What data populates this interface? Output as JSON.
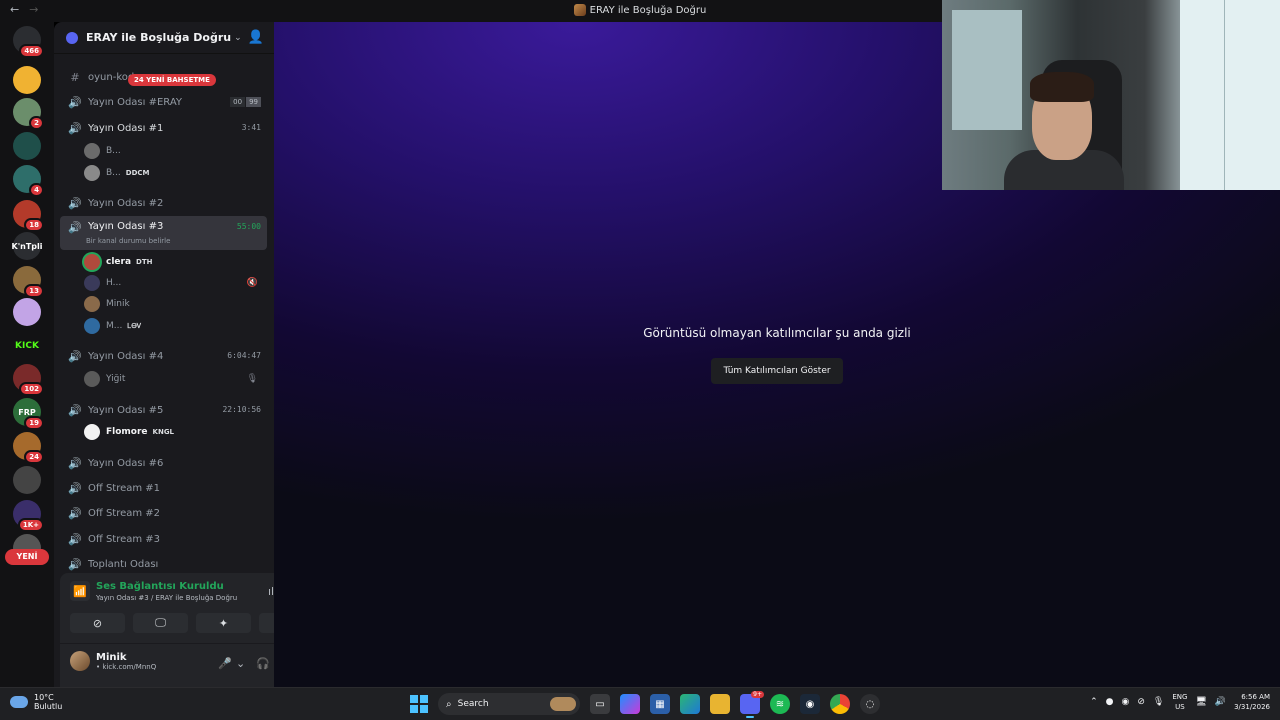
{
  "window": {
    "title": "ERAY ile Boşluğa Doğru",
    "back": "←",
    "forward": "→"
  },
  "rail": {
    "servers": [
      {
        "label": "",
        "badge": "466",
        "color": "#2b2d31"
      },
      {
        "label": "",
        "badge": "",
        "color": "#f0b232"
      },
      {
        "label": "",
        "badge": "2",
        "color": "#6b8e6b"
      },
      {
        "label": "",
        "badge": "",
        "color": "#1f4f4a"
      },
      {
        "label": "",
        "badge": "4",
        "color": "#2e6e6a"
      },
      {
        "label": "",
        "badge": "18",
        "color": "#b33a2a"
      },
      {
        "label": "K'nTpli",
        "badge": "",
        "color": "#2b2d31"
      },
      {
        "label": "",
        "badge": "13",
        "color": "#8a6a3c"
      },
      {
        "label": "",
        "badge": "",
        "color": "#c2a4e6"
      },
      {
        "label": "KICK",
        "badge": "",
        "color": "#121214"
      },
      {
        "label": "",
        "badge": "102",
        "color": "#7a2a2a"
      },
      {
        "label": "FRP",
        "badge": "19",
        "color": "#2c6e3a"
      },
      {
        "label": "",
        "badge": "24",
        "color": "#a66a2c"
      },
      {
        "label": "",
        "badge": "",
        "color": "#444"
      },
      {
        "label": "",
        "badge": "1K+",
        "color": "#3a2e6a"
      },
      {
        "label": "",
        "badge": "",
        "color": "#555"
      }
    ],
    "new_label": "YENİ"
  },
  "server": {
    "name": "ERAY ile Boşluğa Doğru"
  },
  "mention_pill": "24 YENİ BAHSETME",
  "channels": {
    "oyun": "oyun-kodu",
    "c1": {
      "name": "Yayın Odası #ERAY",
      "count_a": "00",
      "count_b": "99"
    },
    "c2": {
      "name": "Yayın Odası #1",
      "timer": "3:41"
    },
    "c2_users": [
      {
        "name": "B...",
        "tag": ""
      },
      {
        "name": "B...",
        "tag": "DDCM"
      }
    ],
    "c3": {
      "name": "Yayın Odası #2"
    },
    "c4": {
      "name": "Yayın Odası #3",
      "timer": "55:00",
      "status": "Bir kanal durumu belirle"
    },
    "c4_users": [
      {
        "name": "clera",
        "tag": "DTH"
      },
      {
        "name": "H...",
        "tag": ""
      },
      {
        "name": "Minik",
        "tag": ""
      },
      {
        "name": "M...",
        "tag": "ᏞᎾᏙ"
      }
    ],
    "c5": {
      "name": "Yayın Odası #4",
      "timer": "6:04:47"
    },
    "c5_users": [
      {
        "name": "Yiğit",
        "tag": ""
      }
    ],
    "c6": {
      "name": "Yayın Odası #5",
      "timer": "22:10:56"
    },
    "c6_users": [
      {
        "name": "Flomore",
        "tag": "KNGL"
      }
    ],
    "c7": {
      "name": "Yayın Odası #6"
    },
    "c8": {
      "name": "Off Stream #1"
    },
    "c9": {
      "name": "Off Stream #2"
    },
    "c10": {
      "name": "Off Stream #3"
    },
    "c11": {
      "name": "Toplantı Odası"
    }
  },
  "voice": {
    "title": "Ses Bağlantısı Kuruldu",
    "subtitle": "Yayın Odası #3 / ERAY ile Boşluğa Doğru"
  },
  "me": {
    "name": "Minik",
    "sub": "• kick.com/MnnQ"
  },
  "stage": {
    "message": "Görüntüsü olmayan katılımcılar şu anda gizli",
    "button": "Tüm Katılımcıları Göster"
  },
  "taskbar": {
    "temp": "10°C",
    "weather": "Bulutlu",
    "search": "Search",
    "discord_badge": "9+",
    "lang1": "ENG",
    "lang2": "US",
    "time": "6:56 AM",
    "date": "3/31/2026"
  }
}
